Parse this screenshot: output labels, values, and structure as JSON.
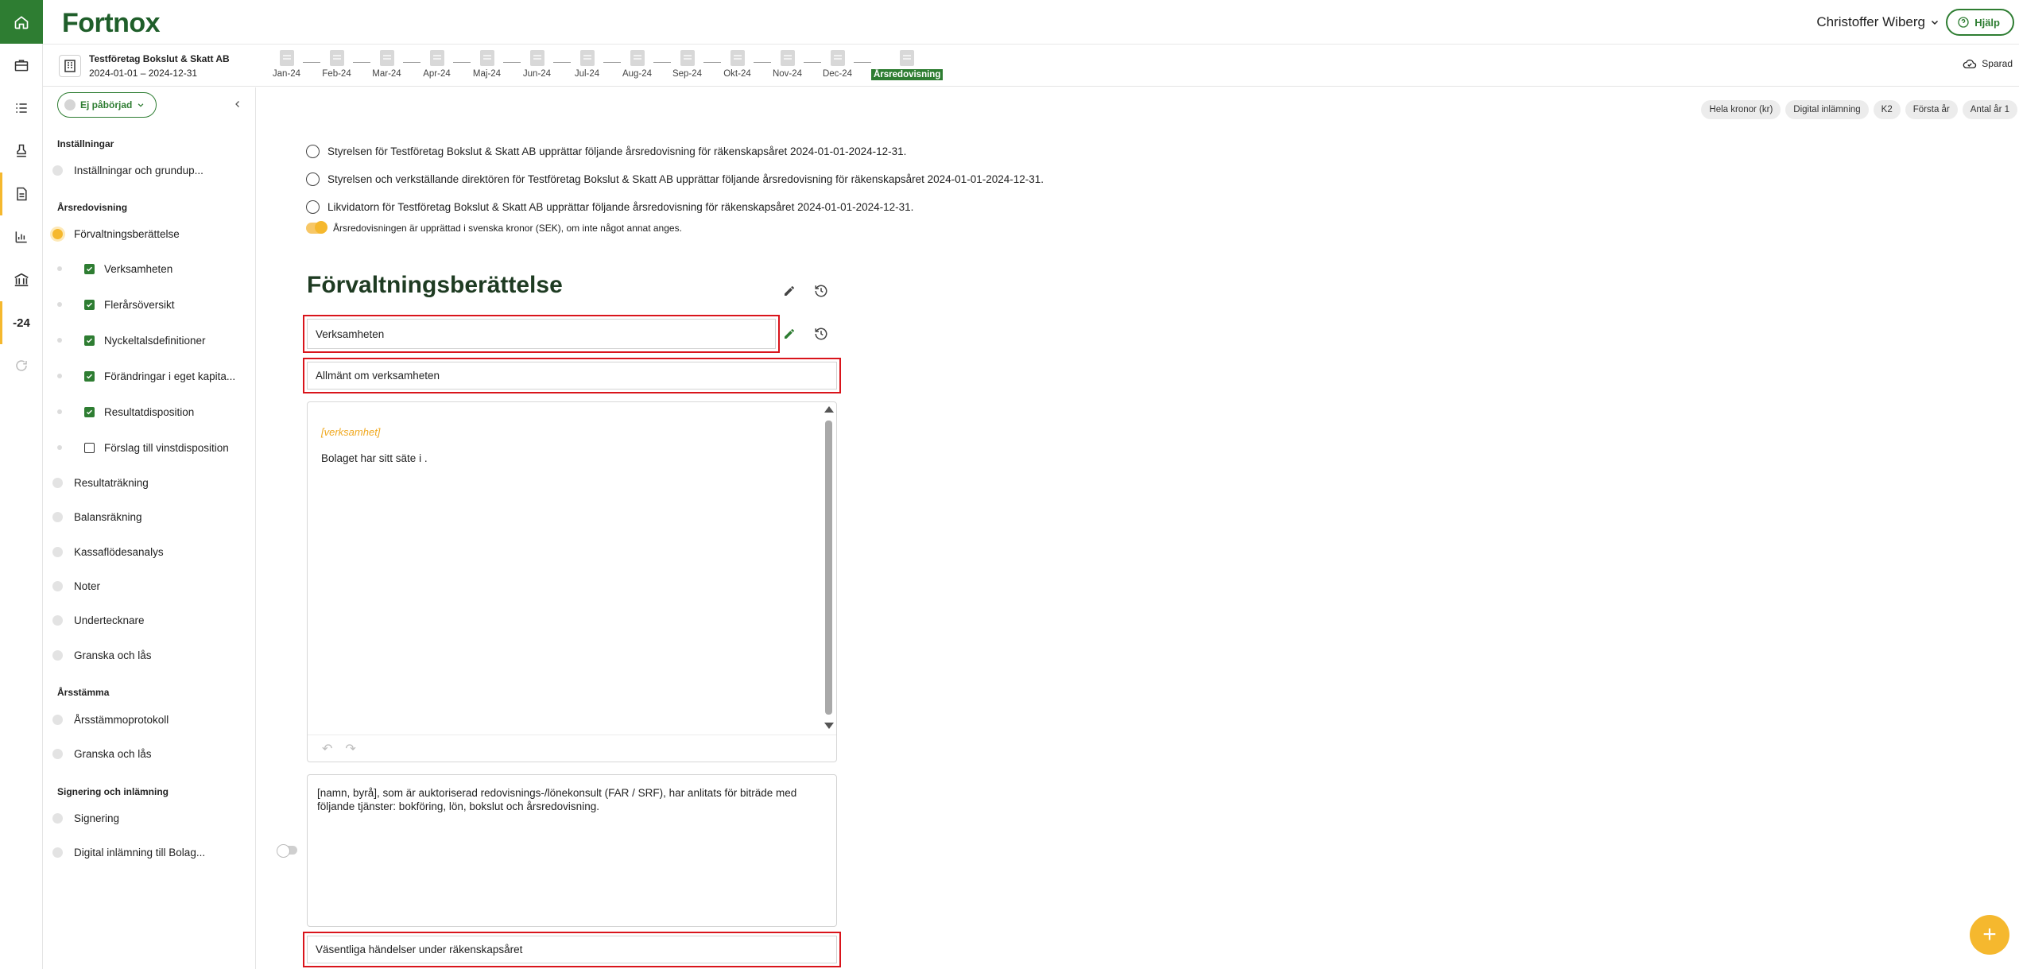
{
  "brand": {
    "logo": "Fortnox"
  },
  "header": {
    "user_name": "Christoffer Wiberg",
    "help_label": "Hjälp"
  },
  "company": {
    "name": "Testföretag Bokslut & Skatt AB",
    "period": "2024-01-01 – 2024-12-31"
  },
  "periods": [
    "Jan-24",
    "Feb-24",
    "Mar-24",
    "Apr-24",
    "Maj-24",
    "Jun-24",
    "Jul-24",
    "Aug-24",
    "Sep-24",
    "Okt-24",
    "Nov-24",
    "Dec-24",
    "Årsredovisning"
  ],
  "saved_label": "Sparad",
  "rail": {
    "year_label": "-24"
  },
  "sidebar": {
    "status_label": "Ej påbörjad",
    "sections": {
      "settings": "Inställningar",
      "annual_report": "Årsredovisning",
      "agm": "Årsstämma",
      "signing": "Signering och inlämning"
    },
    "items": {
      "settings_basics": "Inställningar och grundup...",
      "management_report": "Förvaltningsberättelse",
      "operations": "Verksamheten",
      "multi_year": "Flerårsöversikt",
      "key_ratios": "Nyckeltalsdefinitioner",
      "equity_changes": "Förändringar i eget kapita...",
      "result_disposition": "Resultatdisposition",
      "profit_proposal": "Förslag till vinstdisposition",
      "income_statement": "Resultaträkning",
      "balance_sheet": "Balansräkning",
      "cash_flow": "Kassaflödesanalys",
      "notes": "Noter",
      "signatures": "Undertecknare",
      "review_lock": "Granska och lås",
      "agm_minutes": "Årsstämmoprotokoll",
      "agm_review_lock": "Granska och lås",
      "signing": "Signering",
      "digital_filing": "Digital inlämning till Bolag..."
    }
  },
  "tags": [
    "Hela kronor (kr)",
    "Digital inlämning",
    "K2",
    "Första år",
    "Antal år 1"
  ],
  "options": {
    "board": "Styrelsen för Testföretag Bokslut & Skatt AB upprättar följande årsredovisning för räkenskapsåret 2024-01-01-2024-12-31.",
    "board_ceo": "Styrelsen och verkställande direktören för Testföretag Bokslut & Skatt AB upprättar följande årsredovisning för räkenskapsåret 2024-01-01-2024-12-31.",
    "liquidator": "Likvidatorn för Testföretag Bokslut & Skatt AB upprättar följande årsredovisning för räkenskapsåret 2024-01-01-2024-12-31.",
    "currency_note": "Årsredovisningen är upprättad i svenska kronor (SEK), om inte något annat anges."
  },
  "content": {
    "title": "Förvaltningsberättelse",
    "section_heading": "Verksamheten",
    "subheading": "Allmänt om verksamheten",
    "editor_placeholder": "[verksamhet]",
    "editor_text": "Bolaget har sitt säte i .",
    "consultant_text": "[namn, byrå], som är auktoriserad redovisnings-/lönekonsult (FAR / SRF), har anlitats för biträde med följande tjänster: bokföring, lön, bokslut och årsredovisning.",
    "events_heading": "Väsentliga händelser under räkenskapsåret"
  },
  "colors": {
    "brand_green": "#2e7d32",
    "accent_yellow": "#f5b82e",
    "highlight_red": "#d9141b"
  }
}
